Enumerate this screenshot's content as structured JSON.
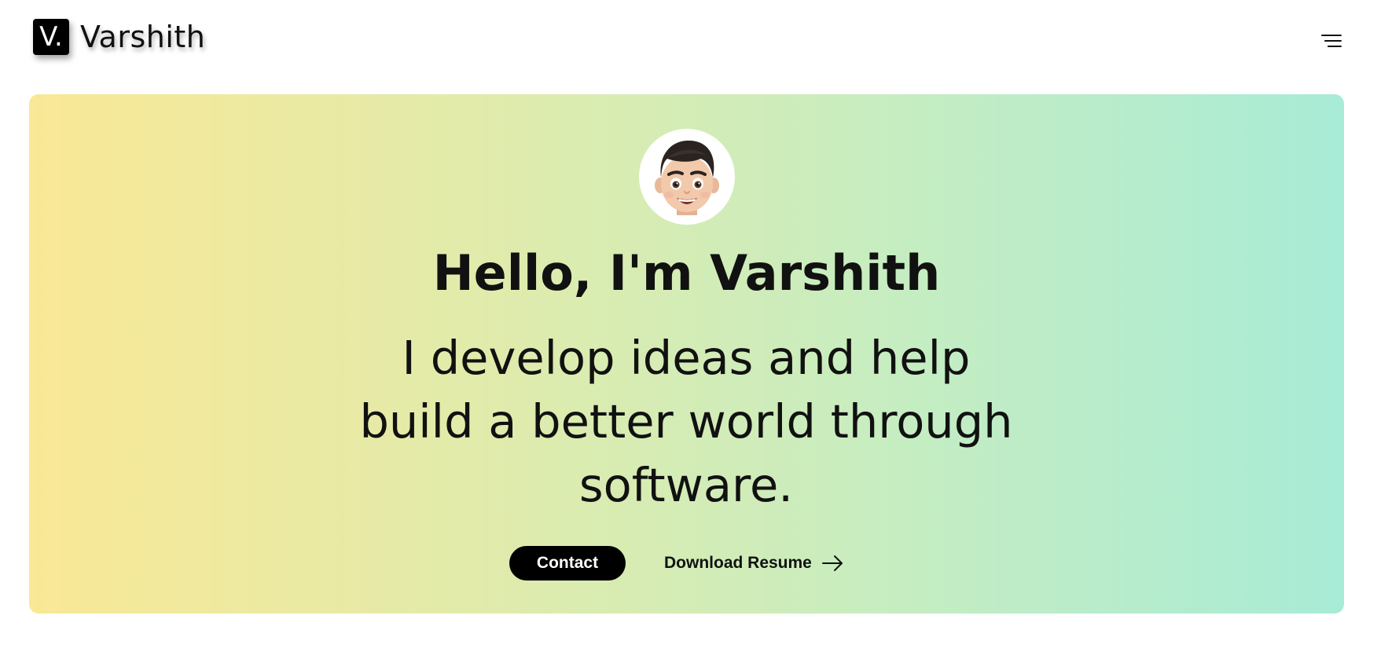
{
  "header": {
    "logo_mark": "V.",
    "logo_text": "Varshith",
    "menu_icon": "hamburger-menu-icon"
  },
  "hero": {
    "avatar_icon": "memoji-avatar-icon",
    "greeting": "Hello, I'm Varshith",
    "tagline_lines": [
      "I develop ideas and help",
      "build a better world through",
      "software."
    ],
    "contact_label": "Contact",
    "resume_label": "Download Resume",
    "resume_icon": "arrow-right-icon",
    "gradient_colors": [
      "#f9e896",
      "#a8ebd6"
    ]
  }
}
